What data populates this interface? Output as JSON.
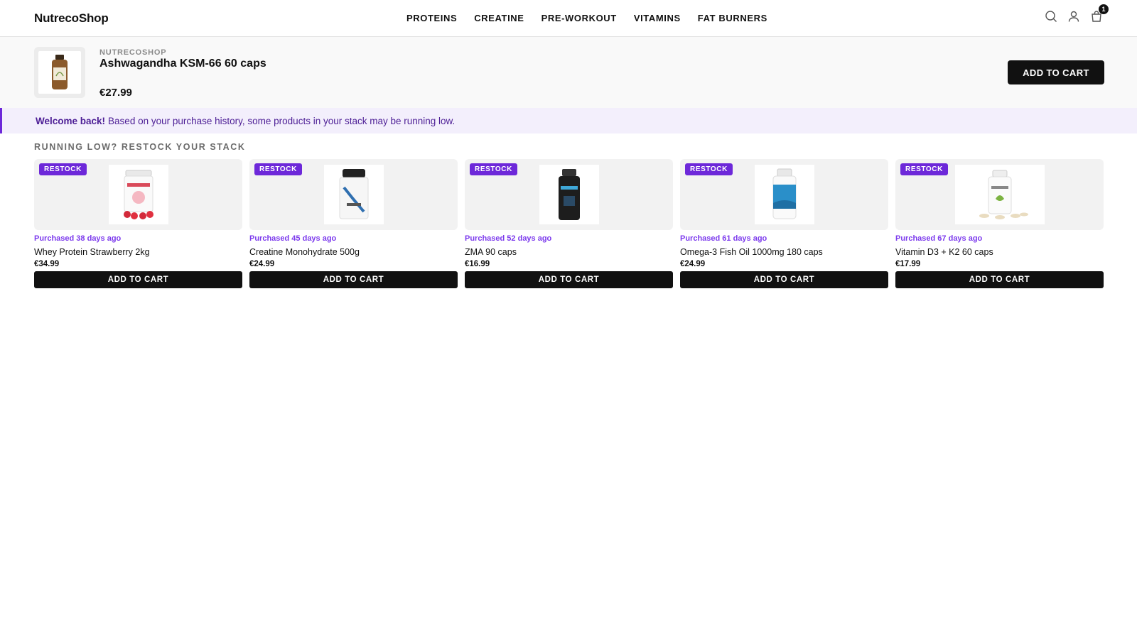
{
  "header": {
    "logo": "NutrecoShop",
    "nav": [
      "PROTEINS",
      "CREATINE",
      "PRE-WORKOUT",
      "VITAMINS",
      "FAT BURNERS"
    ],
    "icons": [
      "search-icon",
      "user-icon",
      "cart-icon"
    ],
    "cart_count": "1"
  },
  "product_bar": {
    "brand": "NUTRECOSHOP",
    "name": "Ashwagandha KSM-66 60 caps",
    "price": "€27.99",
    "add_label": "ADD TO CART"
  },
  "welcome": {
    "bold": "Welcome back!",
    "text": "Based on your purchase history, some products in your stack may be running low."
  },
  "section": {
    "title": "RUNNING LOW? RESTOCK YOUR STACK"
  },
  "cards": [
    {
      "badge": "RESTOCK",
      "purchased": "Purchased 38 days ago",
      "name": "Whey Protein Strawberry 2kg",
      "price": "€34.99",
      "add_label": "ADD TO CART"
    },
    {
      "badge": "RESTOCK",
      "purchased": "Purchased 45 days ago",
      "name": "Creatine Monohydrate 500g",
      "price": "€24.99",
      "add_label": "ADD TO CART"
    },
    {
      "badge": "RESTOCK",
      "purchased": "Purchased 52 days ago",
      "name": "ZMA 90 caps",
      "price": "€16.99",
      "add_label": "ADD TO CART"
    },
    {
      "badge": "RESTOCK",
      "purchased": "Purchased 61 days ago",
      "name": "Omega-3 Fish Oil 1000mg 180 caps",
      "price": "€24.99",
      "add_label": "ADD TO CART"
    },
    {
      "badge": "RESTOCK",
      "purchased": "Purchased 67 days ago",
      "name": "Vitamin D3 + K2 60 caps",
      "price": "€17.99",
      "add_label": "ADD TO CART"
    }
  ],
  "colors": {
    "accent": "#6d28d9",
    "accent_text": "#7c3aed",
    "banner_bg": "#f3effc",
    "button_bg": "#111111"
  }
}
